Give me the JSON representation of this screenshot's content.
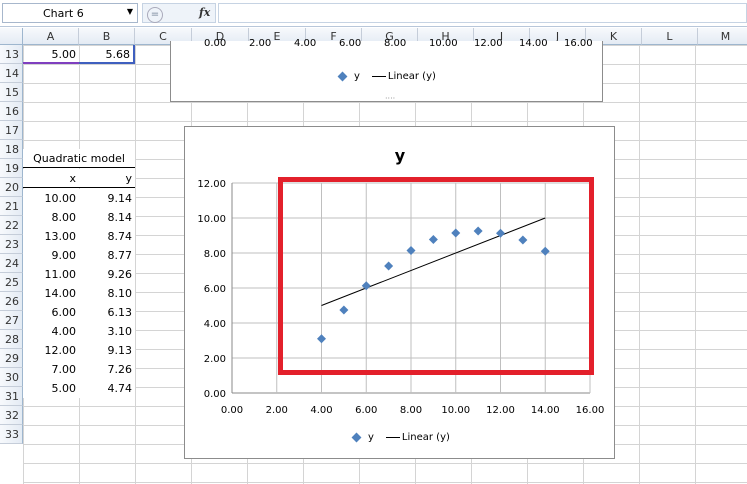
{
  "formula_bar": {
    "name_box": "Chart 6",
    "fx_label": "fx",
    "formula": ""
  },
  "columns": [
    "A",
    "B",
    "C",
    "D",
    "E",
    "F",
    "G",
    "H",
    "I",
    "J",
    "K",
    "L",
    "M"
  ],
  "rows": [
    "13",
    "14",
    "15",
    "16",
    "17",
    "18",
    "19",
    "20",
    "21",
    "22",
    "23",
    "24",
    "25",
    "26",
    "27",
    "28",
    "29",
    "30",
    "31",
    "32",
    "33"
  ],
  "row13": {
    "a": "5.00",
    "b": "5.68"
  },
  "table": {
    "title": "Quadratic model",
    "headers": [
      "x",
      "y"
    ],
    "rows": [
      [
        "10.00",
        "9.14"
      ],
      [
        "8.00",
        "8.14"
      ],
      [
        "13.00",
        "8.74"
      ],
      [
        "9.00",
        "8.77"
      ],
      [
        "11.00",
        "9.26"
      ],
      [
        "14.00",
        "8.10"
      ],
      [
        "6.00",
        "6.13"
      ],
      [
        "4.00",
        "3.10"
      ],
      [
        "12.00",
        "9.13"
      ],
      [
        "7.00",
        "7.26"
      ],
      [
        "5.00",
        "4.74"
      ]
    ]
  },
  "top_chart": {
    "x_ticks": [
      "0.00",
      "2.00",
      "4.00",
      "6.00",
      "8.00",
      "10.00",
      "12.00",
      "14.00",
      "16.00"
    ],
    "legend_series": "y",
    "legend_trend": "Linear (y)"
  },
  "chart_data": {
    "type": "scatter",
    "title": "y",
    "series": [
      {
        "name": "y",
        "points": [
          [
            10,
            9.14
          ],
          [
            8,
            8.14
          ],
          [
            13,
            8.74
          ],
          [
            9,
            8.77
          ],
          [
            11,
            9.26
          ],
          [
            14,
            8.1
          ],
          [
            6,
            6.13
          ],
          [
            4,
            3.1
          ],
          [
            12,
            9.13
          ],
          [
            7,
            7.26
          ],
          [
            5,
            4.74
          ]
        ]
      }
    ],
    "trendline": {
      "name": "Linear (y)",
      "from": [
        4,
        5.0
      ],
      "to": [
        14,
        10.0
      ]
    },
    "xlim": [
      0,
      16
    ],
    "ylim": [
      0,
      12
    ],
    "x_ticks": [
      "0.00",
      "2.00",
      "4.00",
      "6.00",
      "8.00",
      "10.00",
      "12.00",
      "14.00",
      "16.00"
    ],
    "y_ticks": [
      "0.00",
      "2.00",
      "4.00",
      "6.00",
      "8.00",
      "10.00",
      "12.00"
    ],
    "grid": true,
    "legend_position": "bottom",
    "colors": {
      "marker": "#4f81bd",
      "trend": "#000000"
    }
  },
  "highlight_color": "#e3202b"
}
